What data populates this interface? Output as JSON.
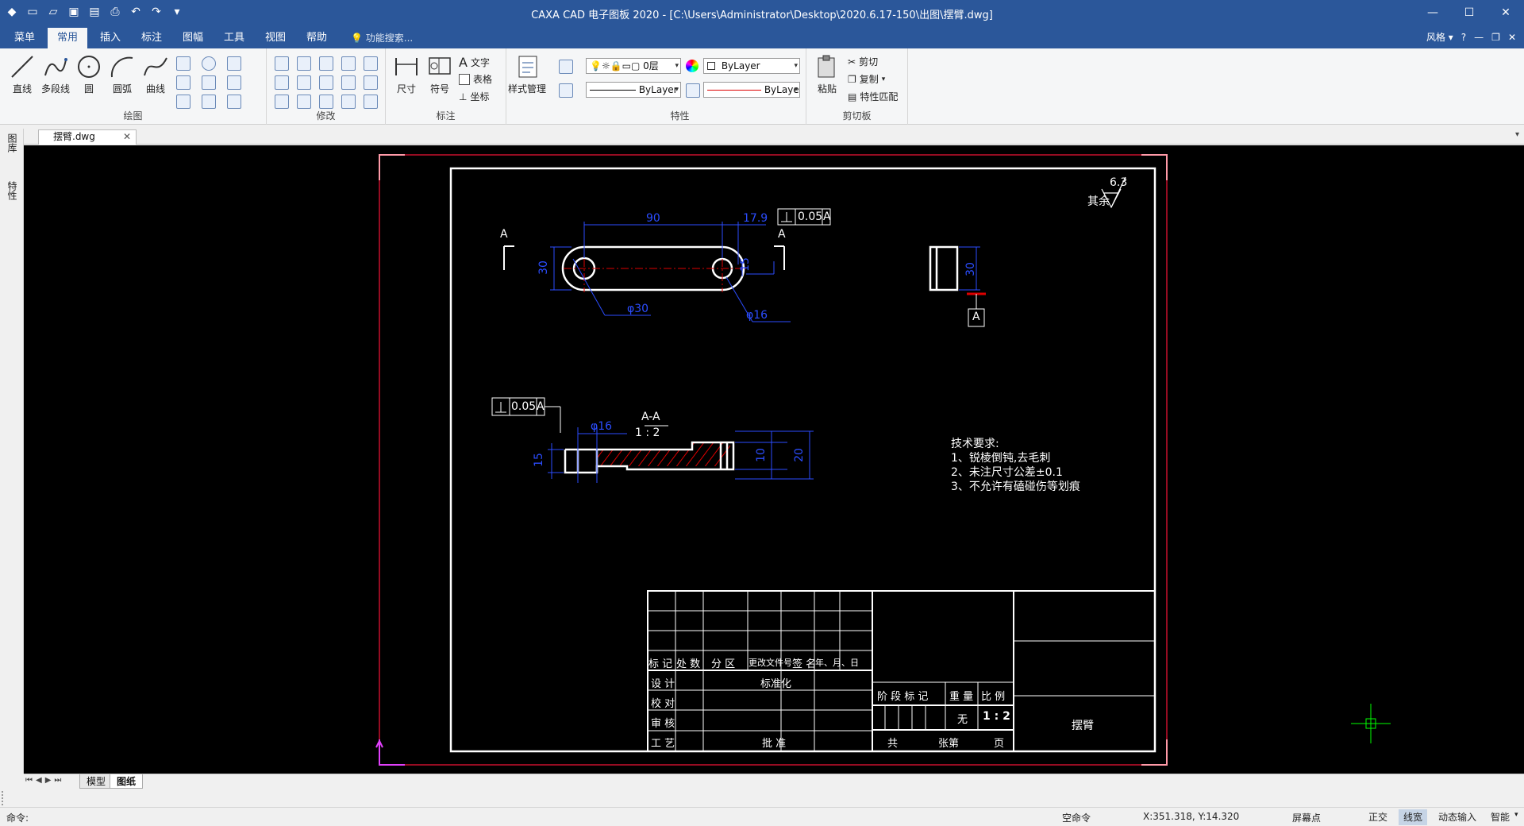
{
  "app": {
    "title": "CAXA CAD 电子图板 2020 - [C:\\Users\\Administrator\\Desktop\\2020.6.17-150\\出图\\摆臂.dwg]"
  },
  "ribbon_tabs": [
    "菜单",
    "常用",
    "插入",
    "标注",
    "图幅",
    "工具",
    "视图",
    "帮助"
  ],
  "active_tab": "常用",
  "search_placeholder": "功能搜索...",
  "style_label": "风格",
  "groups": {
    "draw": {
      "label": "绘图",
      "buttons": [
        "直线",
        "多段线",
        "圆",
        "圆弧",
        "曲线"
      ]
    },
    "modify": {
      "label": "修改"
    },
    "annotate": {
      "label": "标注",
      "buttons": [
        "尺寸",
        "符号"
      ],
      "small": [
        "文字",
        "表格",
        "坐标"
      ]
    },
    "style": {
      "button": "样式管理"
    },
    "properties": {
      "label": "特性",
      "layer": "0层",
      "color": "ByLayer",
      "linetype": "ByLayer",
      "lineweight": "ByLaye"
    },
    "clipboard": {
      "label": "剪切板",
      "paste": "粘贴",
      "small": [
        "剪切",
        "复制",
        "特性匹配"
      ]
    }
  },
  "document_tab": "摆臂.dwg",
  "left_dock": [
    "图库",
    "特性"
  ],
  "drawing": {
    "roughness_label": "其余",
    "roughness_value": "6.3",
    "section_mark_left": "A",
    "section_mark_right": "A",
    "dim_90": "90",
    "dim_17_9": "17.9",
    "dim_30_left": "30",
    "dim_15": "15",
    "dim_phi30": "φ30",
    "dim_phi16_top": "φ16",
    "tol_top": "0.05",
    "tol_top_datum": "A",
    "side_dim_30": "30",
    "datum_A": "A",
    "tol_section": "0.05",
    "tol_section_datum": "A",
    "section_title": "A-A",
    "section_scale": "1 : 2",
    "dim_phi16_section": "φ16",
    "dim_15_section": "15",
    "dim_10": "10",
    "dim_20": "20",
    "tech_title": "技术要求:",
    "tech_1": "1、锐棱倒钝,去毛刺",
    "tech_2": "2、未注尺寸公差±0.1",
    "tech_3": "3、不允许有磕碰伤等划痕",
    "tb_row_labels": [
      "标 记",
      "处 数",
      "分 区",
      "更改文件号",
      "签 名",
      "年、月、日"
    ],
    "tb_left": [
      "设 计",
      "校 对",
      "审 核",
      "工 艺"
    ],
    "tb_std": "标准化",
    "tb_approve": "批 准",
    "tb_stage": [
      "阶 段 标 记",
      "重 量",
      "比 例"
    ],
    "tb_weight": "无",
    "tb_scale": "1 : 2",
    "tb_total": "共",
    "tb_sheet": "张第",
    "tb_page": "页",
    "part_name": "摆臂"
  },
  "layout_tabs": [
    "模型",
    "图纸"
  ],
  "active_layout": "图纸",
  "command_prompt": "命令:",
  "status": {
    "mode": "空命令",
    "coords": "X:351.318, Y:14.320",
    "snap": "屏幕点",
    "toggles": [
      "正交",
      "线宽",
      "动态输入",
      "智能"
    ],
    "active_toggle": "线宽"
  },
  "colors": {
    "title_bar": "#2b579a",
    "canvas": "#000000",
    "dimension_blue": "#2b4dff",
    "sheet_border": "#c8102e"
  }
}
